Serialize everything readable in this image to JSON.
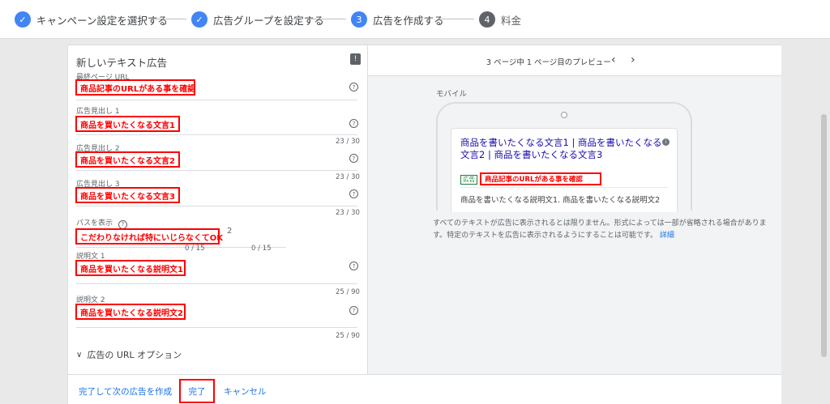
{
  "stepper": {
    "steps": [
      {
        "label": "キャンペーン設定を選択する",
        "state": "done"
      },
      {
        "label": "広告グループを設定する",
        "state": "done"
      },
      {
        "label": "広告を作成する",
        "num": "3",
        "state": "active"
      },
      {
        "label": "料金",
        "num": "4",
        "state": "todo"
      }
    ]
  },
  "form": {
    "title": "新しいテキスト広告",
    "final_url": {
      "label": "最終ページ URL",
      "value": "商品記事のURLがある事を確認"
    },
    "headline1": {
      "label": "広告見出し 1",
      "value": "商品を買いたくなる文言1",
      "count": "23 / 30"
    },
    "headline2": {
      "label": "広告見出し 2",
      "value": "商品を買いたくなる文言2",
      "count": "23 / 30"
    },
    "headline3": {
      "label": "広告見出し 3",
      "value": "商品を買いたくなる文言3",
      "count": "23 / 30"
    },
    "path": {
      "label": "パスを表示",
      "value": "こだわりなければ特にいじらなくてOK",
      "suffix": "2",
      "count1": "0 / 15",
      "count2": "0 / 15"
    },
    "desc1": {
      "label": "説明文 1",
      "value": "商品を買いたくなる説明文1",
      "count": "25 / 90"
    },
    "desc2": {
      "label": "説明文 2",
      "value": "商品を買いたくなる説明文2",
      "count": "25 / 90"
    },
    "url_options": "広告の URL オプション"
  },
  "preview": {
    "page_label": "3 ページ中 1 ページ目のプレビュー",
    "prev": "‹",
    "next": "›",
    "device": "モバイル",
    "headline": "商品を書いたくなる文言1 | 商品を書いたくなる文言2 | 商品を書いたくなる文言3",
    "ad_badge": "広告",
    "display_url": "商品記事のURLがある事を確認",
    "description": "商品を書いたくなる説明文1. 商品を書いたくなる説明文2",
    "note": "すべてのテキストが広告に表示されるとは限りません。形式によっては一部が省略される場合があります。特定のテキストを広告に表示されるようにすることは可能です。",
    "note_link": "詳細"
  },
  "footer": {
    "save_next": "完了して次の広告を作成",
    "done": "完了",
    "cancel": "キャンセル"
  },
  "colors": {
    "accent": "#1a73e8",
    "highlight": "#ff0000"
  }
}
